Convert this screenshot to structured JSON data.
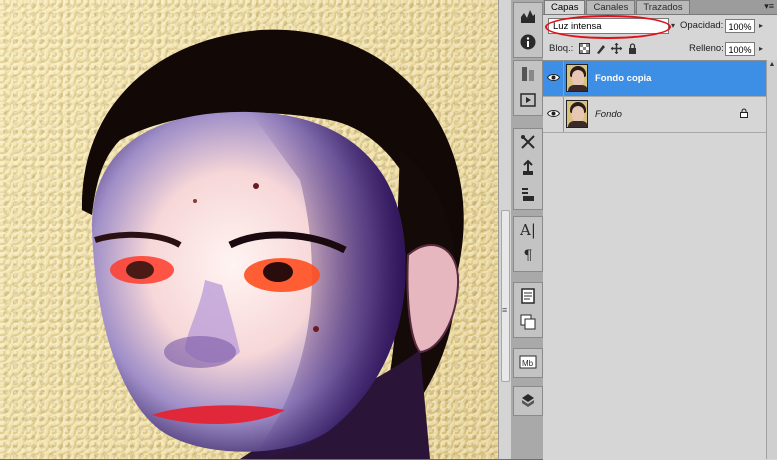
{
  "panel": {
    "tabs": [
      "Capas",
      "Canales",
      "Trazados"
    ],
    "active_tab": "Capas",
    "blend_mode": "Luz intensa",
    "opacity_label": "Opacidad:",
    "opacity_value": "100%",
    "lock_label": "Bloq.:",
    "fill_label": "Relleno:",
    "fill_value": "100%",
    "layers": [
      {
        "name": "Fondo copia",
        "selected": true,
        "locked": false
      },
      {
        "name": "Fondo",
        "selected": false,
        "locked": true
      }
    ]
  },
  "annotation": {
    "circle_color": "#e0101a"
  },
  "colors": {
    "selected_layer": "#3d8ee5"
  }
}
